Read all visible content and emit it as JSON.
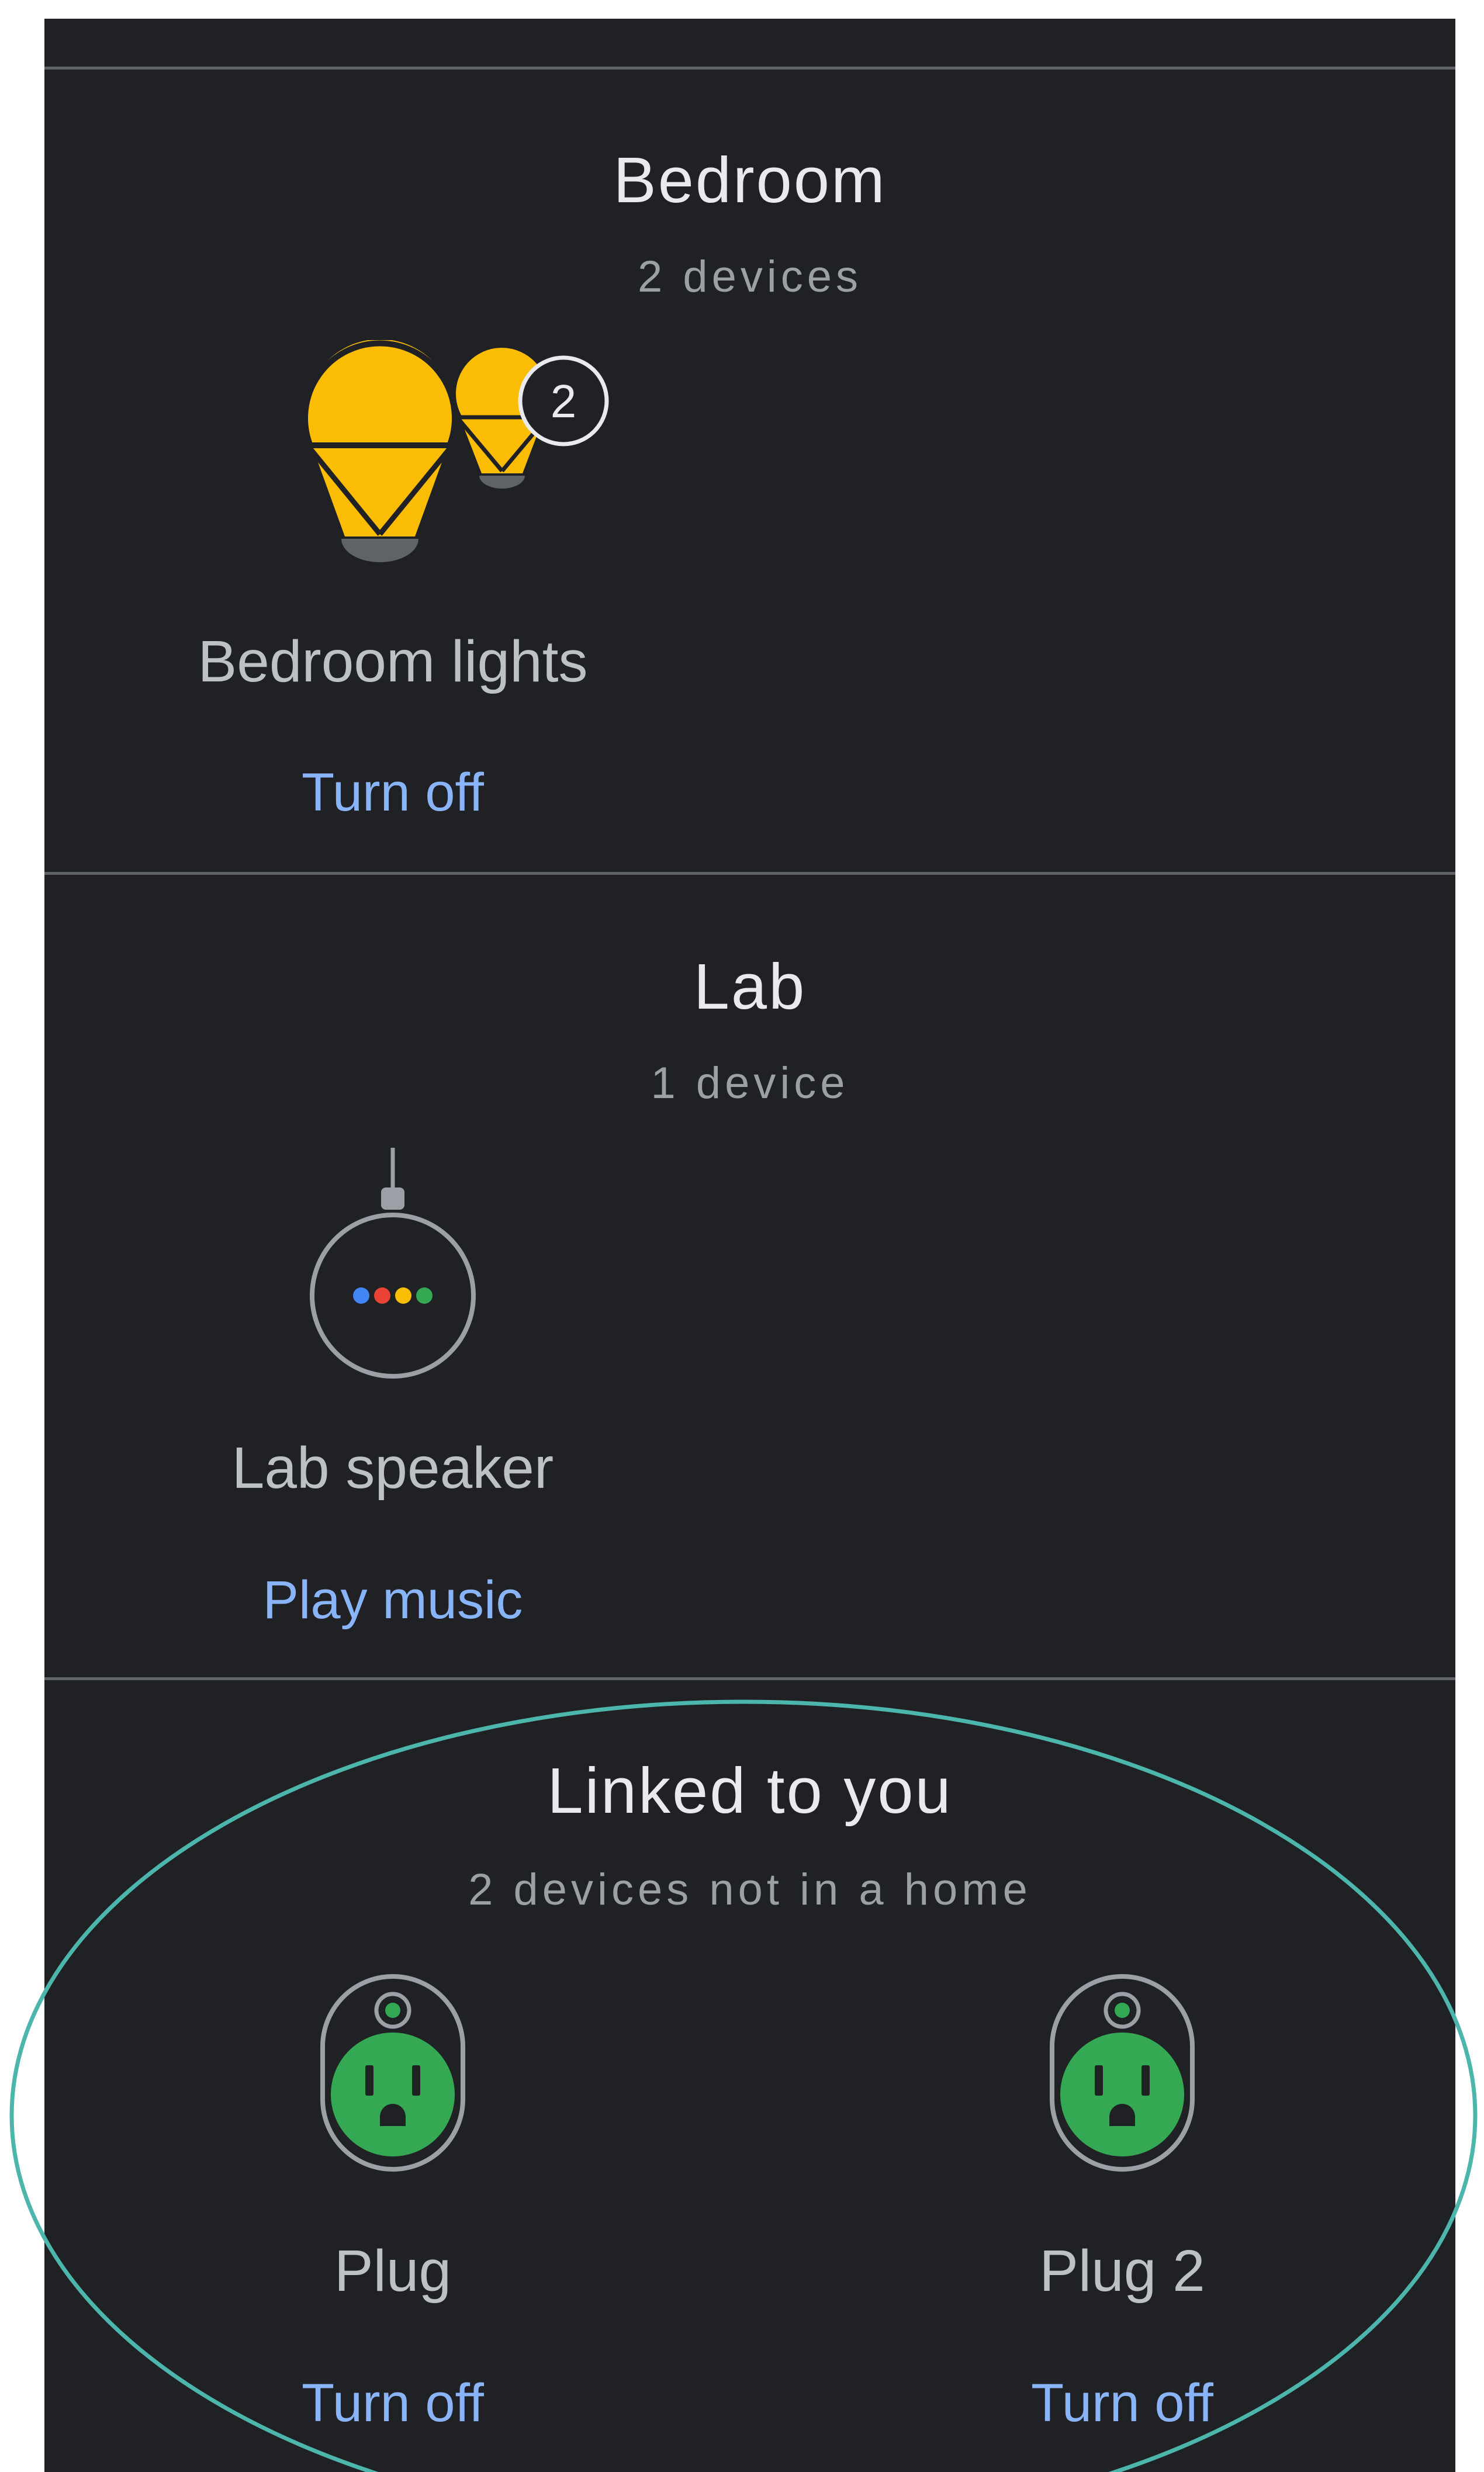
{
  "colors": {
    "background": "#202124",
    "divider": "#5f6368",
    "title": "#e8eaed",
    "subtitle": "#9aa0a6",
    "device_name": "#bdc1c6",
    "action": "#8ab4f8",
    "bulb_yellow": "#fbbc04",
    "plug_green": "#34a853",
    "highlight_ring": "#4db6ac"
  },
  "sections": [
    {
      "title": "Bedroom",
      "subtitle": "2 devices",
      "devices": [
        {
          "name": "Bedroom lights",
          "action": "Turn off",
          "icon": "light-bulbs-icon",
          "badge": "2"
        }
      ]
    },
    {
      "title": "Lab",
      "subtitle": "1 device",
      "devices": [
        {
          "name": "Lab speaker",
          "action": "Play music",
          "icon": "smart-speaker-icon"
        }
      ]
    },
    {
      "title": "Linked to you",
      "subtitle": "2 devices not in a home",
      "devices": [
        {
          "name": "Plug",
          "action": "Turn off",
          "icon": "smart-plug-icon"
        },
        {
          "name": "Plug 2",
          "action": "Turn off",
          "icon": "smart-plug-icon"
        }
      ]
    }
  ]
}
